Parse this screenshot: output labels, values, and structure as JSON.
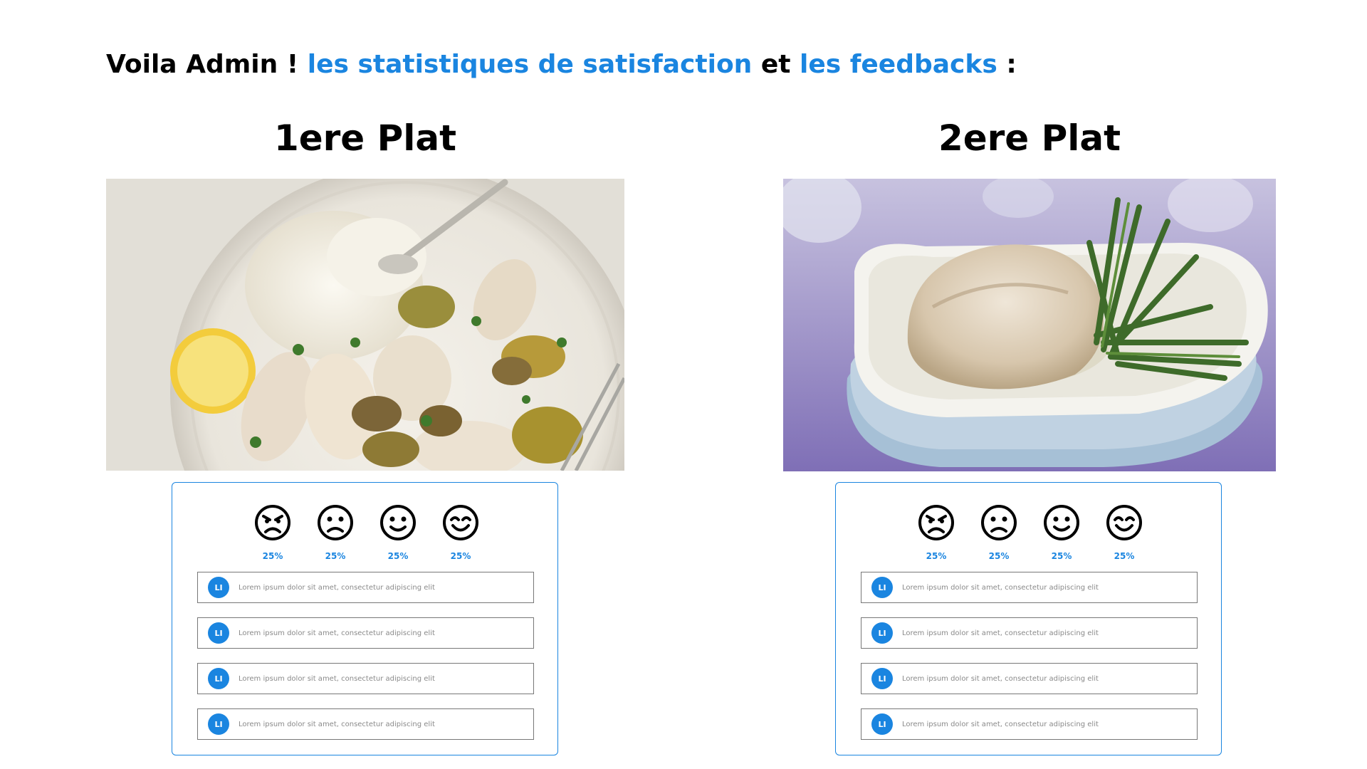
{
  "header": {
    "prefix": "Voila Admin ! ",
    "link_stats": "les statistiques de satisfaction",
    "connector": " et ",
    "link_feedbacks": "les feedbacks",
    "suffix": " :"
  },
  "colors": {
    "accent": "#1a85e0",
    "text": "#000000",
    "muted_text": "#8a8a8a"
  },
  "dishes": [
    {
      "title": "1ere Plat",
      "image_icon": "chicken-rice-mushroom-plate",
      "ratings": [
        {
          "icon": "angry-face-icon",
          "percent": "25%"
        },
        {
          "icon": "sad-face-icon",
          "percent": "25%"
        },
        {
          "icon": "smile-face-icon",
          "percent": "25%"
        },
        {
          "icon": "happy-face-icon",
          "percent": "25%"
        }
      ],
      "feedbacks": [
        {
          "initials": "LI",
          "text": "Lorem ipsum dolor sit amet, consectetur adipiscing elit"
        },
        {
          "initials": "LI",
          "text": "Lorem ipsum dolor sit amet, consectetur adipiscing elit"
        },
        {
          "initials": "LI",
          "text": "Lorem ipsum dolor sit amet, consectetur adipiscing elit"
        },
        {
          "initials": "LI",
          "text": "Lorem ipsum dolor sit amet, consectetur adipiscing elit"
        }
      ]
    },
    {
      "title": "2ere Plat",
      "image_icon": "chicken-green-beans-plate",
      "ratings": [
        {
          "icon": "angry-face-icon",
          "percent": "25%"
        },
        {
          "icon": "sad-face-icon",
          "percent": "25%"
        },
        {
          "icon": "smile-face-icon",
          "percent": "25%"
        },
        {
          "icon": "happy-face-icon",
          "percent": "25%"
        }
      ],
      "feedbacks": [
        {
          "initials": "LI",
          "text": "Lorem ipsum dolor sit amet, consectetur adipiscing elit"
        },
        {
          "initials": "LI",
          "text": "Lorem ipsum dolor sit amet, consectetur adipiscing elit"
        },
        {
          "initials": "LI",
          "text": "Lorem ipsum dolor sit amet, consectetur adipiscing elit"
        },
        {
          "initials": "LI",
          "text": "Lorem ipsum dolor sit amet, consectetur adipiscing elit"
        }
      ]
    }
  ]
}
